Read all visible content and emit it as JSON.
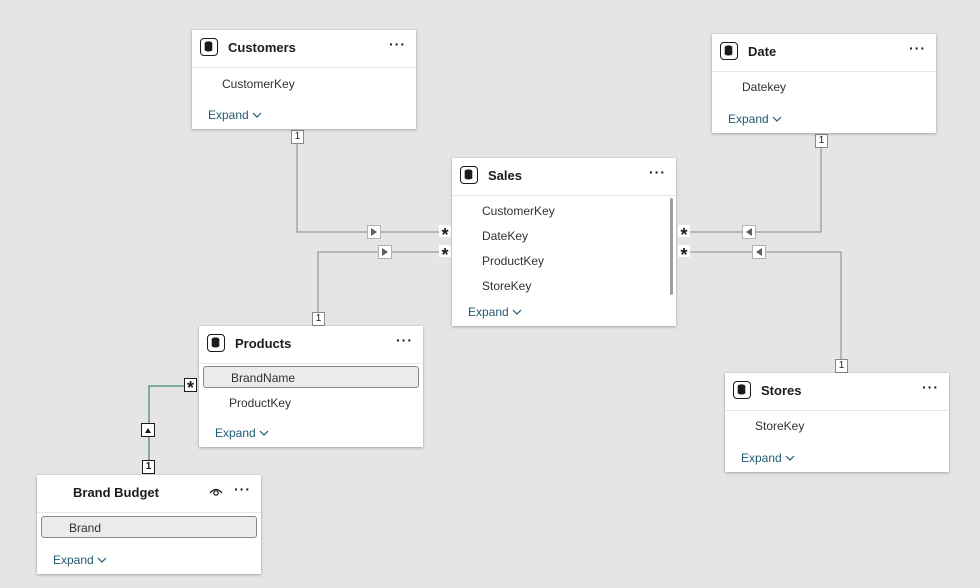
{
  "tables": {
    "customers": {
      "title": "Customers",
      "fields": [
        "CustomerKey"
      ],
      "expand": "Expand"
    },
    "date": {
      "title": "Date",
      "fields": [
        "Datekey"
      ],
      "expand": "Expand"
    },
    "sales": {
      "title": "Sales",
      "fields": [
        "CustomerKey",
        "DateKey",
        "ProductKey",
        "StoreKey"
      ],
      "expand": "Expand"
    },
    "products": {
      "title": "Products",
      "fields": [
        "BrandName",
        "ProductKey"
      ],
      "selected_field": "BrandName",
      "expand": "Expand"
    },
    "stores": {
      "title": "Stores",
      "fields": [
        "StoreKey"
      ],
      "expand": "Expand"
    },
    "brand_budget": {
      "title": "Brand Budget",
      "fields": [
        "Brand"
      ],
      "selected_field": "Brand",
      "expand": "Expand"
    }
  },
  "more_label": "···",
  "relationships": {
    "one_label": "1",
    "many_label": "*"
  },
  "colors": {
    "canvas": "#e6e5e3",
    "line": "#8a8886",
    "active_line": "#1f6e5a",
    "link": "#1f5a73"
  },
  "icons": [
    "table-icon",
    "more-options-icon",
    "chevron-down-icon",
    "filter-direction-arrow-icon",
    "eye-icon"
  ]
}
